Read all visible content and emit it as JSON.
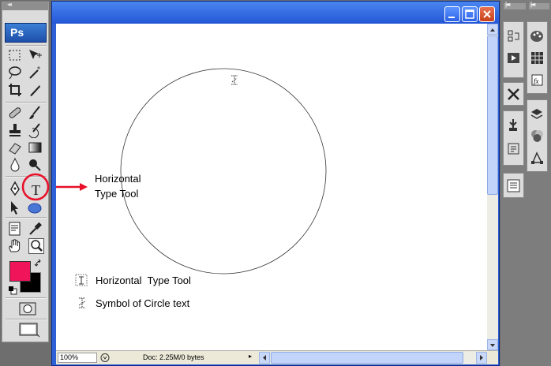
{
  "app": {
    "logo": "Ps"
  },
  "callout": {
    "line1": "Horizontal",
    "line2": "Type Tool"
  },
  "legend": {
    "item1": "Horizontal  Type Tool",
    "item2": "Symbol of Circle text"
  },
  "statusbar": {
    "zoom": "100%",
    "doc_info": "Doc: 2.25M/0 bytes"
  },
  "colors": {
    "foreground": "#f0145a",
    "background": "#000000",
    "callout_red": "#e8102a",
    "titlebar": "#2d5fd6",
    "canvas": "#ffffff"
  },
  "icons": [
    "marquee-icon",
    "move-icon",
    "lasso-icon",
    "magic-wand-icon",
    "crop-icon",
    "slice-icon",
    "healing-brush-icon",
    "brush-icon",
    "clone-stamp-icon",
    "history-brush-icon",
    "eraser-icon",
    "gradient-icon",
    "blur-icon",
    "dodge-icon",
    "pen-icon",
    "type-tool-icon",
    "path-selection-icon",
    "ellipse-shape-icon",
    "notes-icon",
    "eyedropper-icon",
    "hand-icon",
    "zoom-icon",
    "swap-colors-icon",
    "default-colors-icon",
    "quick-mask-icon",
    "screen-mode-icon"
  ]
}
